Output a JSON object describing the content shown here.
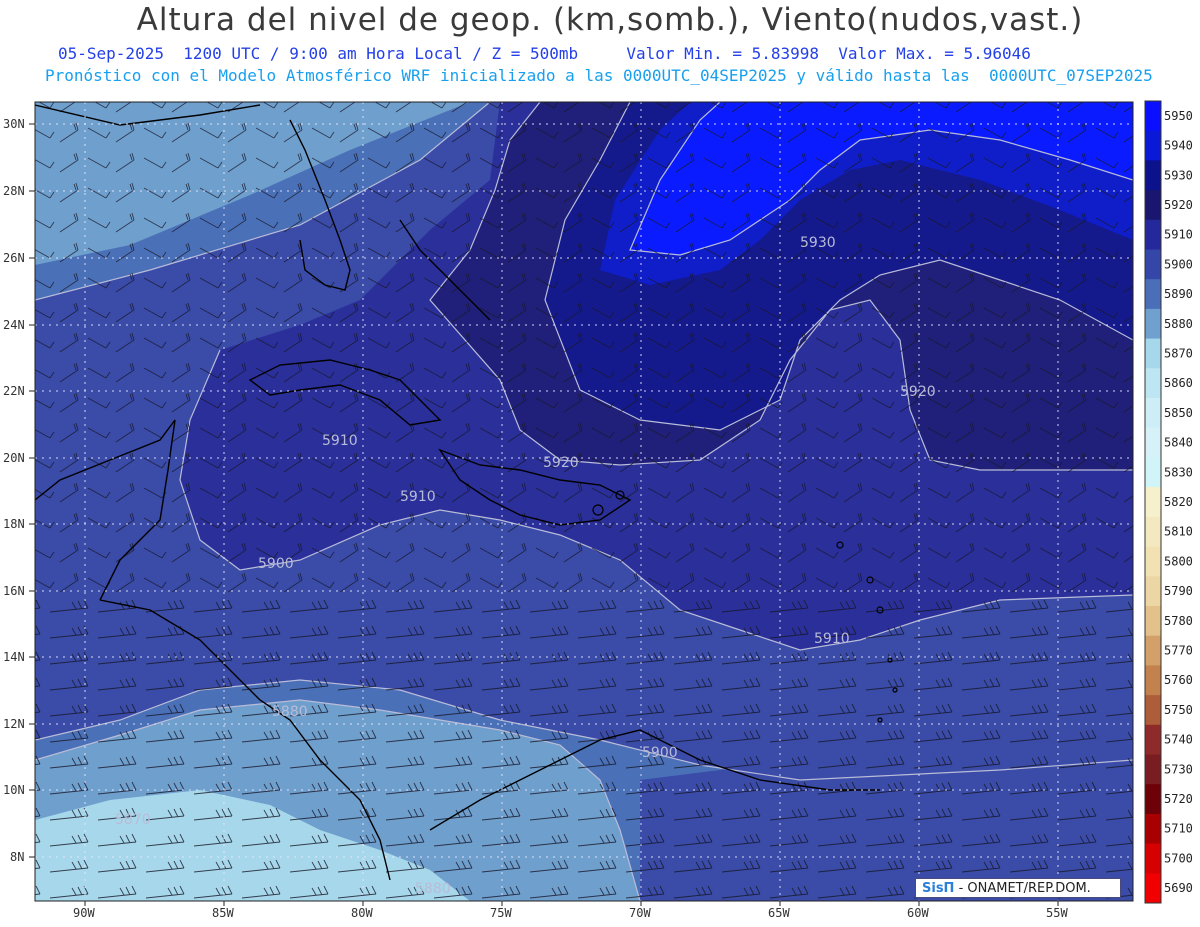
{
  "header": {
    "title": "Altura del nivel de geop. (km,somb.), Viento(nudos,vast.)",
    "date": "05-Sep-2025",
    "time_utc": "1200 UTC / 9:00 am Hora Local / Z = 500mb",
    "min_label": "Valor Min. = 5.83998",
    "max_label": "Valor Max. = 5.96046",
    "model_line": "Pronóstico con el Modelo Atmosférico WRF inicializado a las 0000UTC_04SEP2025 y válido hasta las  0000UTC_07SEP2025"
  },
  "map": {
    "lat_labels": [
      "30N",
      "28N",
      "26N",
      "24N",
      "22N",
      "20N",
      "18N",
      "16N",
      "14N",
      "12N",
      "10N",
      "8N"
    ],
    "lon_labels": [
      "90W",
      "85W",
      "80W",
      "75W",
      "70W",
      "65W",
      "60W",
      "55W"
    ],
    "contour_labels": [
      "5930",
      "5920",
      "5920",
      "5910",
      "5910",
      "5910",
      "5900",
      "5900",
      "5880",
      "5870",
      "5880"
    ],
    "colors": {
      "c5950": "#0a1cff",
      "c5940": "#0f1ec9",
      "c5930": "#141a8c",
      "c5920": "#20207a",
      "c5910": "#2a2f9a",
      "c5900": "#3a4ba8",
      "c5890": "#4a70b8",
      "c5880": "#6f9fcd",
      "c5870": "#a7d7ea"
    }
  },
  "colorbar": {
    "levels": [
      "5950",
      "5940",
      "5930",
      "5920",
      "5910",
      "5900",
      "5890",
      "5880",
      "5870",
      "5860",
      "5850",
      "5840",
      "5830",
      "5820",
      "5810",
      "5800",
      "5790",
      "5780",
      "5770",
      "5760",
      "5750",
      "5740",
      "5730",
      "5720",
      "5710",
      "5700",
      "5690"
    ],
    "colors": [
      "#0a10ff",
      "#0a18d8",
      "#0c128c",
      "#1a1670",
      "#24289a",
      "#3446a8",
      "#4a6fb8",
      "#6fa0cf",
      "#a7d7ea",
      "#bde6f2",
      "#cdeef6",
      "#d6f2f8",
      "#d0f4f7",
      "#f7f0cc",
      "#f4e8c0",
      "#f2e2b3",
      "#ecd6a3",
      "#e3c18a",
      "#d4a06a",
      "#c3824d",
      "#ad5d3a",
      "#8f2a2a",
      "#7a1d22",
      "#6e0008",
      "#a80000",
      "#d60000",
      "#f00000"
    ]
  },
  "credit": {
    "logo": "SisΠ",
    "text": "- ONAMET/REP.DOM."
  }
}
